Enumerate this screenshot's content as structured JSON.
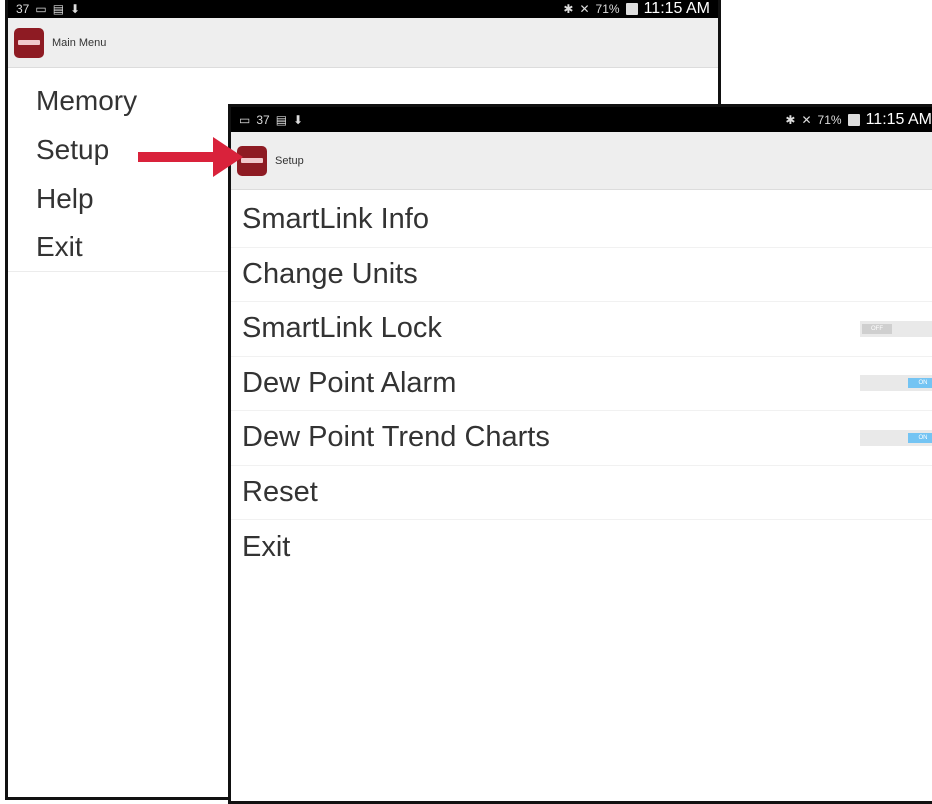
{
  "main_screen": {
    "status": {
      "left_glyphs": "37",
      "time": "11:15 AM",
      "battery": "71%"
    },
    "title": "Main Menu",
    "menu": [
      {
        "label": "Memory"
      },
      {
        "label": "Setup"
      },
      {
        "label": "Help"
      },
      {
        "label": "Exit"
      }
    ]
  },
  "setup_screen": {
    "status": {
      "left_glyphs": "37",
      "time": "11:15 AM",
      "battery": "71%"
    },
    "title": "Setup",
    "menu": [
      {
        "label": "SmartLink Info"
      },
      {
        "label": "Change Units"
      },
      {
        "label": "SmartLink Lock",
        "toggle": "OFF"
      },
      {
        "label": "Dew Point Alarm",
        "toggle": "ON"
      },
      {
        "label": "Dew Point Trend Charts",
        "toggle": "ON"
      },
      {
        "label": "Reset"
      },
      {
        "label": "Exit"
      }
    ]
  },
  "colors": {
    "brand": "#8e1b23",
    "arrow": "#d9223b",
    "toggle_on": "#74c4f3",
    "toggle_off": "#cfcfcf"
  }
}
